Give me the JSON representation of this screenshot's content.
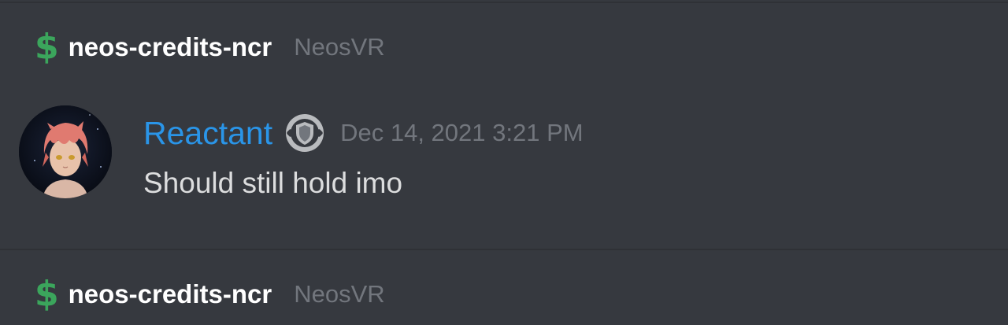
{
  "channel_header_top": {
    "icon": "dollar-icon",
    "symbol": "$",
    "channel_name": "neos-credits-ncr",
    "server_name": "NeosVR"
  },
  "message": {
    "avatar": "avatar",
    "username": "Reactant",
    "badge": "shield-badge-icon",
    "timestamp": "Dec 14, 2021 3:21 PM",
    "text": "Should still hold imo"
  },
  "channel_header_bottom": {
    "icon": "dollar-icon",
    "symbol": "$",
    "channel_name": "neos-credits-ncr",
    "server_name": "NeosVR"
  },
  "colors": {
    "background": "#36393f",
    "username": "#2a95e8",
    "muted": "#72767d",
    "text": "#dcddde",
    "dollar": "#3ba55c"
  }
}
